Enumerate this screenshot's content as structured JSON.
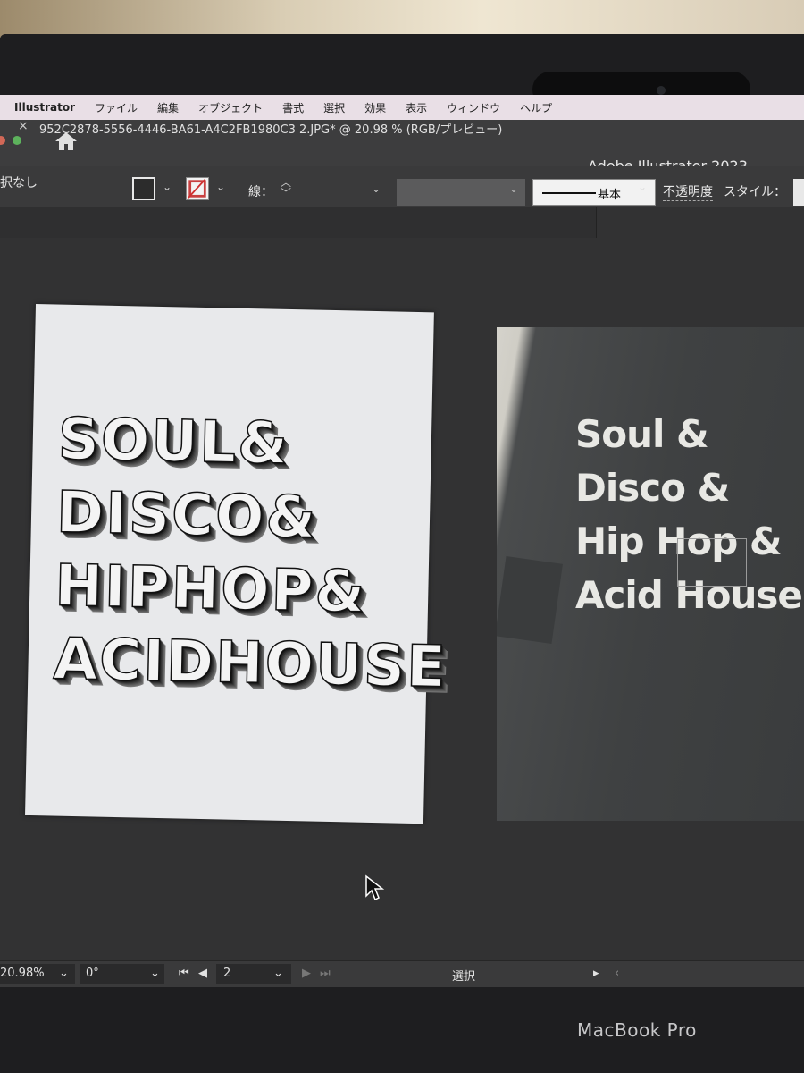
{
  "menubar": {
    "app_name": "Illustrator",
    "items": [
      "ファイル",
      "編集",
      "オブジェクト",
      "書式",
      "選択",
      "効果",
      "表示",
      "ウィンドウ",
      "ヘルプ"
    ]
  },
  "titlebar": {
    "title": "Adobe Illustrator 2023",
    "home_icon": "home-icon"
  },
  "control_bar": {
    "selection_status": "択なし",
    "stroke_label": "線：",
    "brush_label": "基本",
    "opacity_label": "不透明度",
    "style_label": "スタイル："
  },
  "document_tab": {
    "close_glyph": "×",
    "title": "952C2878-5556-4446-BA61-A4C2FB1980C3 2.JPG* @ 20.98 % (RGB/プレビュー)"
  },
  "artboard": {
    "lines": [
      "SOUL&",
      "DISCO&",
      "HIPHOP&",
      "ACIDHOUSE"
    ]
  },
  "photo": {
    "lines": [
      "Soul &",
      "Disco &",
      "Hip Hop &",
      "Acid House"
    ]
  },
  "statusbar": {
    "zoom": "20.98%",
    "rotation": "0°",
    "artboard_number": "2",
    "tool_status": "選択"
  },
  "device": {
    "brand": "MacBook Pro"
  }
}
